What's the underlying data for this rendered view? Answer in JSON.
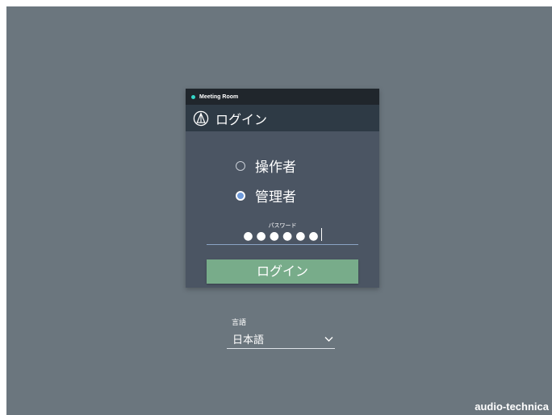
{
  "room": {
    "name": "Meeting Room",
    "status_color": "#35d7c8"
  },
  "dialog": {
    "title": "ログイン",
    "logo_icon": "audio-technica-logo-icon"
  },
  "roles": [
    {
      "label": "操作者",
      "selected": false
    },
    {
      "label": "管理者",
      "selected": true
    }
  ],
  "password": {
    "label": "パスワード",
    "masked_value": "●●●●●●"
  },
  "login_button": {
    "label": "ログイン",
    "color": "#78ac8a"
  },
  "language": {
    "label": "言語",
    "selected": "日本語"
  },
  "brand": "audio-technica"
}
